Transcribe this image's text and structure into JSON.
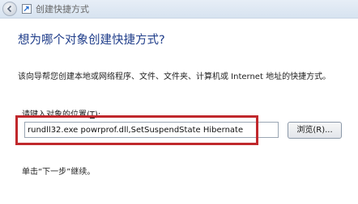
{
  "window": {
    "title": "创建快捷方式"
  },
  "icons": {
    "back": "back-arrow-icon",
    "app": "shortcut-icon"
  },
  "main": {
    "heading": "想为哪个对象创建快捷方式?",
    "description": "该向导帮您创建本地或网络程序、文件、文件夹、计算机或 Internet 地址的快捷方式。",
    "location_label_prefix": "请键入对象的位置(",
    "location_label_key": "T",
    "location_label_suffix": "):",
    "location_value": "rundll32.exe powrprof.dll,SetSuspendState Hibernate",
    "browse_label": "浏览(R)...",
    "next_hint": "单击“下一步”继续。"
  },
  "colors": {
    "heading": "#1f3d8a",
    "highlight": "#c0282c"
  }
}
